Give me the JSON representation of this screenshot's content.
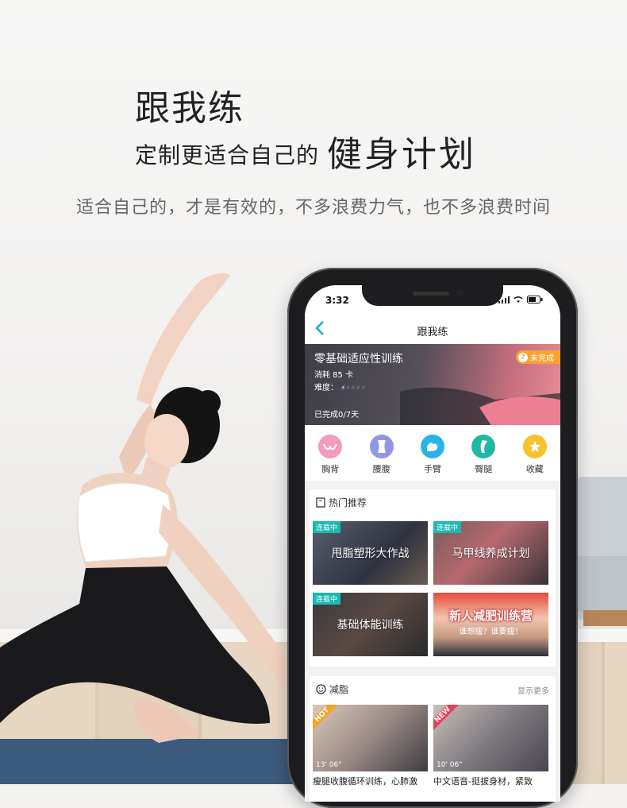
{
  "hero": {
    "title": "跟我练",
    "subtitle_prefix": "定制更适合自己的",
    "subtitle_emph": "健身计划",
    "description": "适合自己的，才是有效的，不多浪费力气，也不多浪费时间"
  },
  "phone": {
    "status_time": "3:32",
    "nav_title": "跟我练",
    "banner": {
      "title": "零基础适应性训练",
      "calories": "消耗 85 卡",
      "difficulty_label": "难度：",
      "difficulty_level": 1,
      "difficulty_max": 5,
      "progress": "已完成0/7天",
      "status_badge": "未完成"
    },
    "categories": [
      {
        "label": "胸背",
        "icon": "chest-icon",
        "color": "#f39ac0"
      },
      {
        "label": "腰腹",
        "icon": "waist-icon",
        "color": "#8f96e8"
      },
      {
        "label": "手臂",
        "icon": "arm-icon",
        "color": "#28b4e6"
      },
      {
        "label": "臀腿",
        "icon": "leg-icon",
        "color": "#1fb9a3"
      },
      {
        "label": "收藏",
        "icon": "star-icon",
        "color": "#f9c12e"
      }
    ],
    "hot": {
      "header": "热门推荐",
      "tiles": [
        {
          "tag": "连载中",
          "title": "甩脂塑形大作战"
        },
        {
          "tag": "连载中",
          "title": "马甲线养成计划"
        },
        {
          "tag": "连载中",
          "title": "基础体能训练"
        },
        {
          "title": "新人减肥训练营",
          "subtitle": "谁想瘦？谁要瘦！"
        }
      ]
    },
    "fat": {
      "header": "减脂",
      "more": "显示更多",
      "videos": [
        {
          "ribbon": "HOT",
          "duration": "13' 06\"",
          "title": "瘦腿收腹循环训练，心肺激"
        },
        {
          "ribbon": "NEW",
          "duration": "10' 06\"",
          "title": "中文语音-挺拔身材，紧致"
        }
      ]
    }
  }
}
